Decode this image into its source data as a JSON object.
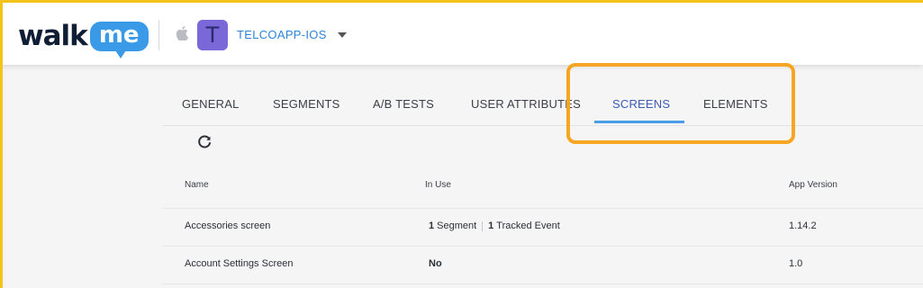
{
  "header": {
    "logo_walk": "walk",
    "logo_me": "me",
    "platform_icon": "apple-icon",
    "app_avatar_letter": "T",
    "app_name": "TELCOAPP-IOS",
    "brand_colors": {
      "logo_dark": "#0f1e35",
      "logo_bubble": "#3b9ae8",
      "app_avatar": "#7a67d8",
      "app_name": "#2d84d8"
    }
  },
  "tabs": [
    {
      "label": "GENERAL",
      "active": false
    },
    {
      "label": "SEGMENTS",
      "active": false
    },
    {
      "label": "A/B TESTS",
      "active": false
    },
    {
      "label": "USER ATTRIBUTES",
      "active": false
    },
    {
      "label": "SCREENS",
      "active": true
    },
    {
      "label": "ELEMENTS",
      "active": false
    }
  ],
  "highlight_color": "#f6a623",
  "toolbar": {
    "refresh_icon": "refresh-icon"
  },
  "table": {
    "columns": [
      "Name",
      "In Use",
      "App Version"
    ],
    "rows": [
      {
        "name": "Accessories screen",
        "in_use": {
          "segment_count": "1",
          "segment_label": "Segment",
          "event_count": "1",
          "event_label": "Tracked Event"
        },
        "app_version": "1.14.2"
      },
      {
        "name": "Account Settings Screen",
        "in_use": {
          "text": "No"
        },
        "app_version": "1.0"
      }
    ]
  }
}
